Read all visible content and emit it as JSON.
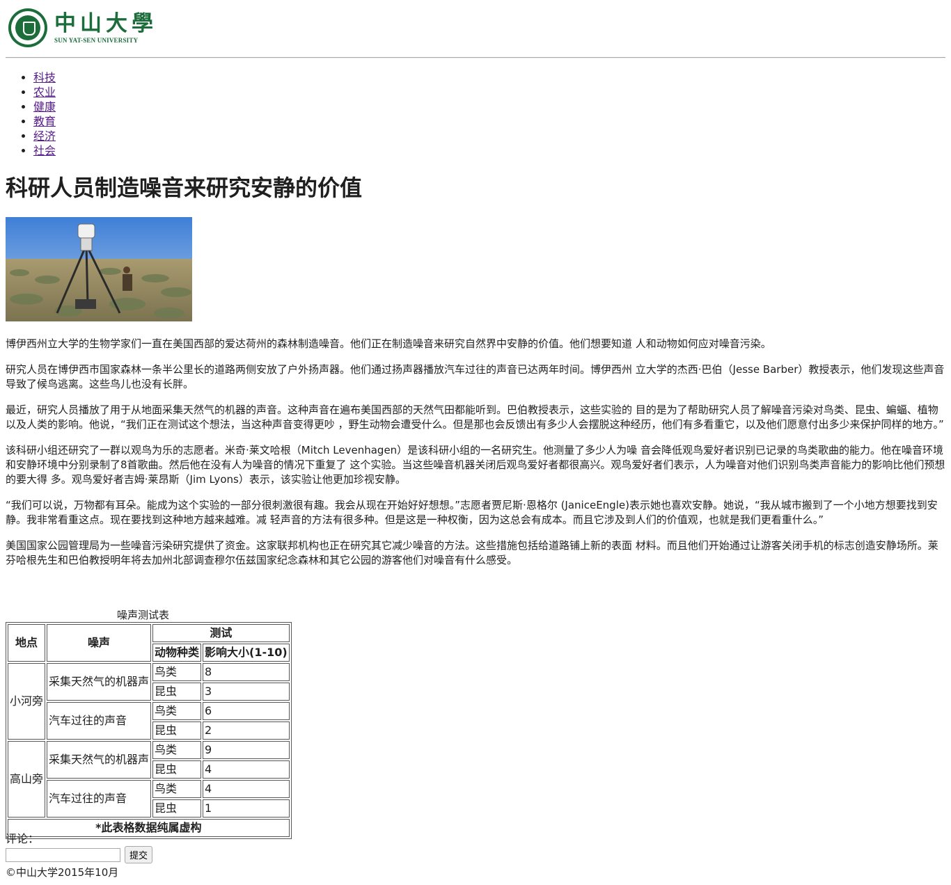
{
  "logo": {
    "cn": "中山大學",
    "en": "SUN YAT-SEN UNIVERSITY",
    "seal": "sysu-seal-logo"
  },
  "nav": [
    "科技",
    "农业",
    "健康",
    "教育",
    "经济",
    "社会"
  ],
  "title": "科研人员制造噪音来研究安静的价值",
  "paragraphs": [
    "博伊西州立大学的生物学家们一直在美国西部的爱达荷州的森林制造噪音。他们正在制造噪音来研究自然界中安静的价值。他们想要知道 人和动物如何应对噪音污染。",
    "研究人员在博伊西市国家森林一条半公里长的道路两侧安放了户外扬声器。他们通过扬声器播放汽车过往的声音已达两年时间。博伊西州 立大学的杰西·巴伯（Jesse Barber）教授表示，他们发现这些声音导致了候鸟逃离。这些鸟儿也没有长胖。",
    "最近，研究人员播放了用于从地面采集天然气的机器的声音。这种声音在遍布美国西部的天然气田都能听到。巴伯教授表示，这些实验的 目的是为了帮助研究人员了解噪音污染对鸟类、昆虫、蝙蝠、植物以及人类的影响。他说，“我们正在测试这个想法，当这种声音变得更吵 ，野生动物会遭受什么。但是那也会反馈出有多少人会摆脱这种经历，他们有多看重它，以及他们愿意付出多少来保护同样的地方。”",
    "该科研小组还研究了一群以观鸟为乐的志愿者。米奇·莱文哈根（Mitch Levenhagen）是该科研小组的一名研究生。他测量了多少人为噪 音会降低观鸟爱好者识别已记录的鸟类歌曲的能力。他在噪音环境和安静环境中分别录制了8首歌曲。然后他在没有人为噪音的情况下重复了 这个实验。当这些噪音机器关闭后观鸟爱好者都很高兴。观鸟爱好者们表示，人为噪音对他们识别鸟类声音能力的影响比他们预想的要大得 多。观鸟爱好者吉姆·莱昂斯（Jim Lyons）表示，该实验让他更加珍视安静。",
    "“我们可以说，万物都有耳朵。能成为这个实验的一部分很刺激很有趣。我会从现在开始好好想想。”志愿者贾尼斯·恩格尔 (JaniceEngle)表示她也喜欢安静。她说，“我从城市搬到了一个小地方想要找到安静。我非常看重这点。现在要找到这种地方越来越难。减 轻声音的方法有很多种。但是这是一种权衡，因为这总会有成本。而且它涉及到人们的价值观，也就是我们更看重什么。”",
    "美国国家公园管理局为一些噪音污染研究提供了资金。这家联邦机构也正在研究其它减少噪音的方法。这些措施包括给道路铺上新的表面 材料。而且他们开始通过让游客关闭手机的标志创造安静场所。莱芬哈根先生和巴伯教授明年将去加州北部调查穆尔伍兹国家纪念森林和其它公园的游客他们对噪音有什么感受。"
  ],
  "table": {
    "caption": "噪声测试表",
    "headers": {
      "place": "地点",
      "noise": "噪声",
      "test": "测试",
      "species": "动物种类",
      "impact": "影响大小(1-10)"
    },
    "rows": [
      {
        "place": "小河旁",
        "noise": "采集天然气的机器声",
        "species": "鸟类",
        "value": "8"
      },
      {
        "place": "小河旁",
        "noise": "采集天然气的机器声",
        "species": "昆虫",
        "value": "3"
      },
      {
        "place": "小河旁",
        "noise": "汽车过往的声音",
        "species": "鸟类",
        "value": "6"
      },
      {
        "place": "小河旁",
        "noise": "汽车过往的声音",
        "species": "昆虫",
        "value": "2"
      },
      {
        "place": "高山旁",
        "noise": "采集天然气的机器声",
        "species": "鸟类",
        "value": "9"
      },
      {
        "place": "高山旁",
        "noise": "采集天然气的机器声",
        "species": "昆虫",
        "value": "4"
      },
      {
        "place": "高山旁",
        "noise": "汽车过往的声音",
        "species": "鸟类",
        "value": "4"
      },
      {
        "place": "高山旁",
        "noise": "汽车过往的声音",
        "species": "昆虫",
        "value": "1"
      }
    ],
    "footnote": "*此表格数据纯属虚构"
  },
  "comment": {
    "label": "评论：",
    "value": "",
    "submit_label": "提交"
  },
  "footer": "©中山大学2015年10月"
}
